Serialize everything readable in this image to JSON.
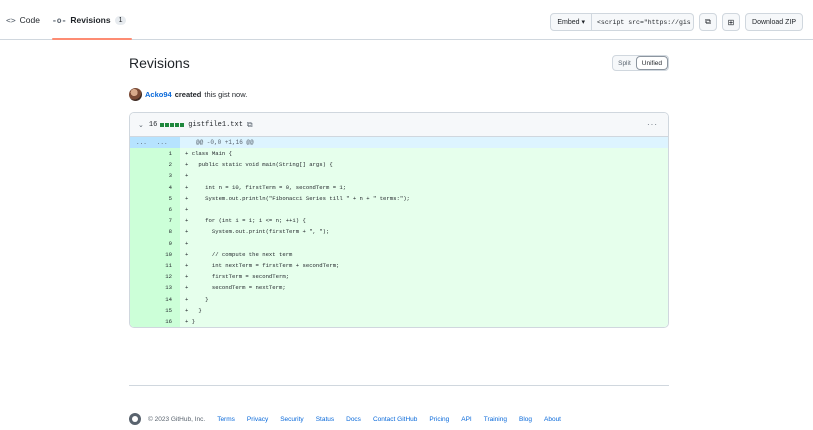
{
  "tabs": [
    {
      "icon": "<>",
      "label": "Code"
    },
    {
      "icon": "-o-",
      "label": "Revisions",
      "count": "1"
    }
  ],
  "actions": {
    "embed_label": "Embed ▾",
    "embed_value": "<script src=\"https://gis",
    "copy_icon": "⧉",
    "desktop_icon": "⊞",
    "download_label": "Download ZIP"
  },
  "page": {
    "title": "Revisions",
    "split_label": "Split",
    "unified_label": "Unified"
  },
  "revision": {
    "author": "Acko94",
    "verb": "created",
    "suffix": "this gist now."
  },
  "file": {
    "changes": "16",
    "name": "gistfile1.txt",
    "menu": "···",
    "hunk_left": "...",
    "hunk_right": "...",
    "hunk_header": "@@ -0,0 +1,16 @@",
    "lines": [
      {
        "n": "1",
        "code": "+ class Main {"
      },
      {
        "n": "2",
        "code": "+   public static void main(String[] args) {"
      },
      {
        "n": "3",
        "code": "+"
      },
      {
        "n": "4",
        "code": "+     int n = 10, firstTerm = 0, secondTerm = 1;"
      },
      {
        "n": "5",
        "code": "+     System.out.println(\"Fibonacci Series till \" + n + \" terms:\");"
      },
      {
        "n": "6",
        "code": "+"
      },
      {
        "n": "7",
        "code": "+     for (int i = 1; i <= n; ++i) {"
      },
      {
        "n": "8",
        "code": "+       System.out.print(firstTerm + \", \");"
      },
      {
        "n": "9",
        "code": "+"
      },
      {
        "n": "10",
        "code": "+       // compute the next term"
      },
      {
        "n": "11",
        "code": "+       int nextTerm = firstTerm + secondTerm;"
      },
      {
        "n": "12",
        "code": "+       firstTerm = secondTerm;"
      },
      {
        "n": "13",
        "code": "+       secondTerm = nextTerm;"
      },
      {
        "n": "14",
        "code": "+     }"
      },
      {
        "n": "15",
        "code": "+   }"
      },
      {
        "n": "16",
        "code": "+ }"
      }
    ]
  },
  "footer": {
    "copyright": "© 2023 GitHub, Inc.",
    "links": [
      "Terms",
      "Privacy",
      "Security",
      "Status",
      "Docs",
      "Contact GitHub",
      "Pricing",
      "API",
      "Training",
      "Blog",
      "About"
    ]
  }
}
